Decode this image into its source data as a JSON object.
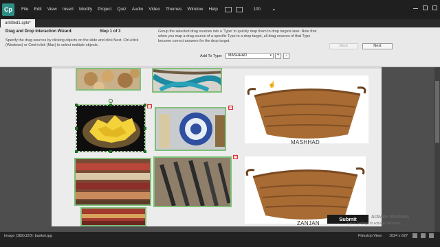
{
  "app": {
    "logo": "Cp",
    "menu": [
      "File",
      "Edit",
      "View",
      "Insert",
      "Modify",
      "Project",
      "Quiz",
      "Audio",
      "Video",
      "Themes",
      "Window",
      "Help"
    ],
    "zoom": "100",
    "tab": "untitled1.cptx*"
  },
  "wizard": {
    "title": "Drag and Drop Interaction Wizard:",
    "step": "Step  1  of  3",
    "description": "Specify the drag sources by clicking objects on the slide and click Next. Ctrl+click (Windows) or Cmd+click (Mac) to select multiple objects.",
    "help": "Group the selected drag sources into a 'Type' to quickly map them to drop targets later. Note that when you map a drag source of a specific Type to a drop target, all drag sources of that Type become correct answers for the drop target.",
    "add_type_label": "Add To Type:",
    "type_value": "MASHHAD",
    "plus_label": "+",
    "minus_label": "-",
    "back_label": "Back",
    "next_label": "Next"
  },
  "slide": {
    "targets": [
      {
        "label": "MASHHAD"
      },
      {
        "label": "ZANJAN"
      }
    ],
    "drag_marks": [
      "[-]",
      "[-]",
      "[-]"
    ],
    "submit_label": "Submit",
    "watermark": "Activate Windows",
    "watermark_sub": "Go to Settings to activate Windows."
  },
  "status": {
    "selection": "Image (182x120): basket.jpg",
    "view": "Filmstrip View",
    "dimensions": "1024 x 627"
  },
  "colors": {
    "selected_border": "#7fbf7a",
    "handle": "#1c6f24",
    "drag_mark": "#dd3333"
  }
}
